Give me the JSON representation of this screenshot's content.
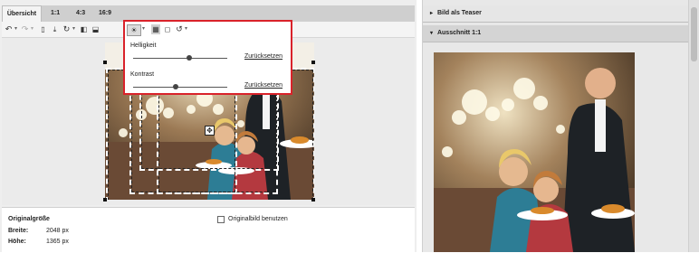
{
  "tabs": [
    {
      "label": "Übersicht",
      "active": true
    },
    {
      "label": "1:1",
      "active": false
    },
    {
      "label": "4:3",
      "active": false
    },
    {
      "label": "16:9",
      "active": false
    }
  ],
  "toolbar": {
    "undo_icon": "undo-icon",
    "redo_icon": "redo-icon",
    "caret": "▾"
  },
  "popup": {
    "brightness_label": "Helligkeit",
    "brightness_value": 0.6,
    "contrast_label": "Kontrast",
    "contrast_value": 0.45,
    "reset_label": "Zurücksetzen"
  },
  "info": {
    "original_size_label": "Originalgröße",
    "width_label": "Breite:",
    "width_value": "2048 px",
    "height_label": "Höhe:",
    "height_value": "1365 px",
    "use_original_label": "Originalbild benutzen"
  },
  "right_panel": {
    "teaser_header": "Bild als Teaser",
    "crop_header": "Ausschnitt 1:1"
  },
  "colors": {
    "highlight_border": "#d9222a",
    "panel_bg": "#eeeeee",
    "tab_bar": "#cfcfcf"
  }
}
